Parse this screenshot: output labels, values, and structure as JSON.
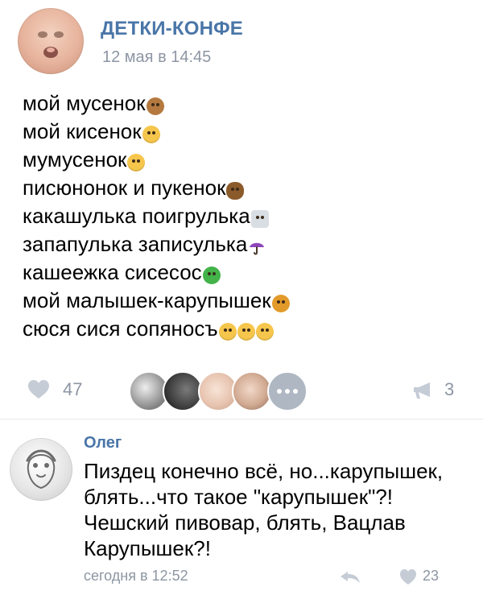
{
  "post": {
    "group_name": "ДЕТКИ-КОНФЕ",
    "date": "12 мая в 14:45",
    "lines": [
      {
        "text": "мой мусенок",
        "emoji": "face-brown"
      },
      {
        "text": "мой кисенок",
        "emoji": "face-yellow"
      },
      {
        "text": "мумусенок",
        "emoji": "face-yellow"
      },
      {
        "text": "писюнонок и пукенок",
        "emoji": "face-poo"
      },
      {
        "text": "какашулька поигрулька",
        "emoji": "robot"
      },
      {
        "text": "запапулька записулька",
        "emoji": "umbrella"
      },
      {
        "text": "кашеежка сисесос",
        "emoji": "frog"
      },
      {
        "text": "мой малышек-карупышек",
        "emoji": "lion"
      },
      {
        "text": "сюся сися сопяносъ",
        "emoji": "face-yellow"
      }
    ],
    "likes_count": "47",
    "shares_count": "3"
  },
  "comment": {
    "author": "Олег",
    "text": "Пиздец конечно всё, но...карупышек, блять...что такое \"карупышек\"?! Чешский пивовар, блять, Вацлав Карупышек?!",
    "time": "сегодня в 12:52",
    "likes_count": "23"
  },
  "icons": {
    "like": "heart-icon",
    "share": "megaphone-icon",
    "reply": "reply-arrow-icon",
    "more": "more-dots-icon"
  },
  "colors": {
    "brand_blue": "#4a76a8",
    "muted_gray": "#8d96a3",
    "divider": "#e7e8ec"
  }
}
